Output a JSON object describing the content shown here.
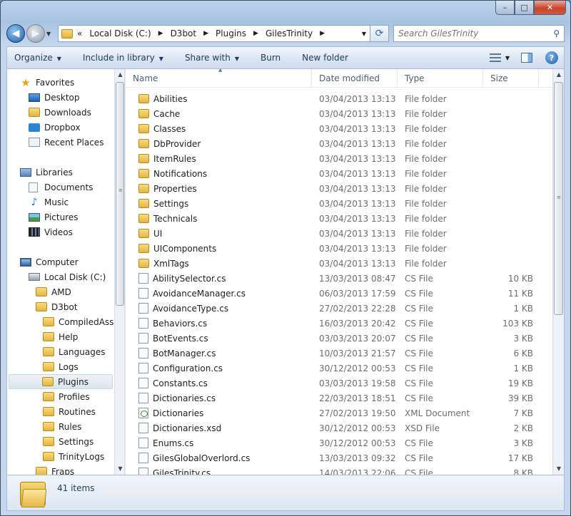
{
  "window": {
    "caption_buttons": {
      "minimize": "–",
      "maximize": "□",
      "close": "✕"
    }
  },
  "address": {
    "overflow": "«",
    "crumbs": [
      "Local Disk (C:)",
      "D3bot",
      "Plugins",
      "GilesTrinity"
    ],
    "search_placeholder": "Search GilesTrinity"
  },
  "toolbar": {
    "organize": "Organize",
    "include_in_library": "Include in library",
    "share_with": "Share with",
    "burn": "Burn",
    "new_folder": "New folder"
  },
  "nav": {
    "favorites": [
      "Favorites",
      "Desktop",
      "Downloads",
      "Dropbox",
      "Recent Places"
    ],
    "libraries": [
      "Libraries",
      "Documents",
      "Music",
      "Pictures",
      "Videos"
    ],
    "computer": "Computer",
    "disk": "Local Disk (C:)",
    "amd": "AMD",
    "d3bot": "D3bot",
    "d3bot_children": [
      "CompiledAss",
      "Help",
      "Languages",
      "Logs",
      "Plugins",
      "Profiles",
      "Routines",
      "Rules",
      "Settings",
      "TrinityLogs"
    ],
    "after": "Fraps",
    "selected": "Plugins"
  },
  "columns": {
    "name": "Name",
    "date": "Date modified",
    "type": "Type",
    "size": "Size"
  },
  "files": [
    {
      "name": "Abilities",
      "date": "03/04/2013 13:13",
      "type": "File folder",
      "size": "",
      "icon": "folder-icon"
    },
    {
      "name": "Cache",
      "date": "03/04/2013 13:13",
      "type": "File folder",
      "size": "",
      "icon": "folder-icon"
    },
    {
      "name": "Classes",
      "date": "03/04/2013 13:13",
      "type": "File folder",
      "size": "",
      "icon": "folder-icon"
    },
    {
      "name": "DbProvider",
      "date": "03/04/2013 13:13",
      "type": "File folder",
      "size": "",
      "icon": "folder-icon"
    },
    {
      "name": "ItemRules",
      "date": "03/04/2013 13:13",
      "type": "File folder",
      "size": "",
      "icon": "folder-icon"
    },
    {
      "name": "Notifications",
      "date": "03/04/2013 13:13",
      "type": "File folder",
      "size": "",
      "icon": "folder-icon"
    },
    {
      "name": "Properties",
      "date": "03/04/2013 13:13",
      "type": "File folder",
      "size": "",
      "icon": "folder-icon"
    },
    {
      "name": "Settings",
      "date": "03/04/2013 13:13",
      "type": "File folder",
      "size": "",
      "icon": "folder-icon"
    },
    {
      "name": "Technicals",
      "date": "03/04/2013 13:13",
      "type": "File folder",
      "size": "",
      "icon": "folder-icon"
    },
    {
      "name": "UI",
      "date": "03/04/2013 13:13",
      "type": "File folder",
      "size": "",
      "icon": "folder-icon"
    },
    {
      "name": "UIComponents",
      "date": "03/04/2013 13:13",
      "type": "File folder",
      "size": "",
      "icon": "folder-icon"
    },
    {
      "name": "XmlTags",
      "date": "03/04/2013 13:13",
      "type": "File folder",
      "size": "",
      "icon": "folder-icon"
    },
    {
      "name": "AbilitySelector.cs",
      "date": "13/03/2013 08:47",
      "type": "CS File",
      "size": "10 KB",
      "icon": "file-icon"
    },
    {
      "name": "AvoidanceManager.cs",
      "date": "06/03/2013 17:59",
      "type": "CS File",
      "size": "11 KB",
      "icon": "file-icon"
    },
    {
      "name": "AvoidanceType.cs",
      "date": "27/02/2013 22:28",
      "type": "CS File",
      "size": "1 KB",
      "icon": "file-icon"
    },
    {
      "name": "Behaviors.cs",
      "date": "16/03/2013 20:42",
      "type": "CS File",
      "size": "103 KB",
      "icon": "file-icon"
    },
    {
      "name": "BotEvents.cs",
      "date": "03/03/2013 20:07",
      "type": "CS File",
      "size": "3 KB",
      "icon": "file-icon"
    },
    {
      "name": "BotManager.cs",
      "date": "10/03/2013 21:57",
      "type": "CS File",
      "size": "6 KB",
      "icon": "file-icon"
    },
    {
      "name": "Configuration.cs",
      "date": "30/12/2012 00:53",
      "type": "CS File",
      "size": "1 KB",
      "icon": "file-icon"
    },
    {
      "name": "Constants.cs",
      "date": "03/03/2013 19:58",
      "type": "CS File",
      "size": "19 KB",
      "icon": "file-icon"
    },
    {
      "name": "Dictionaries.cs",
      "date": "22/03/2013 18:51",
      "type": "CS File",
      "size": "39 KB",
      "icon": "file-icon"
    },
    {
      "name": "Dictionaries",
      "date": "27/02/2013 19:50",
      "type": "XML Document",
      "size": "7 KB",
      "icon": "xml-icon"
    },
    {
      "name": "Dictionaries.xsd",
      "date": "30/12/2012 00:53",
      "type": "XSD File",
      "size": "2 KB",
      "icon": "file-icon"
    },
    {
      "name": "Enums.cs",
      "date": "30/12/2012 00:53",
      "type": "CS File",
      "size": "3 KB",
      "icon": "file-icon"
    },
    {
      "name": "GilesGlobalOverlord.cs",
      "date": "13/03/2013 09:32",
      "type": "CS File",
      "size": "17 KB",
      "icon": "file-icon"
    },
    {
      "name": "GilesTrinity.cs",
      "date": "14/03/2013 22:06",
      "type": "CS File",
      "size": "8 KB",
      "icon": "file-icon"
    }
  ],
  "status": {
    "item_count": "41 items"
  },
  "icons": {
    "back": "arrow-left-icon",
    "forward": "arrow-right-icon",
    "refresh": "refresh-icon",
    "search": "search-icon",
    "help": "help-icon",
    "views": "views-icon",
    "preview": "preview-pane-icon"
  }
}
